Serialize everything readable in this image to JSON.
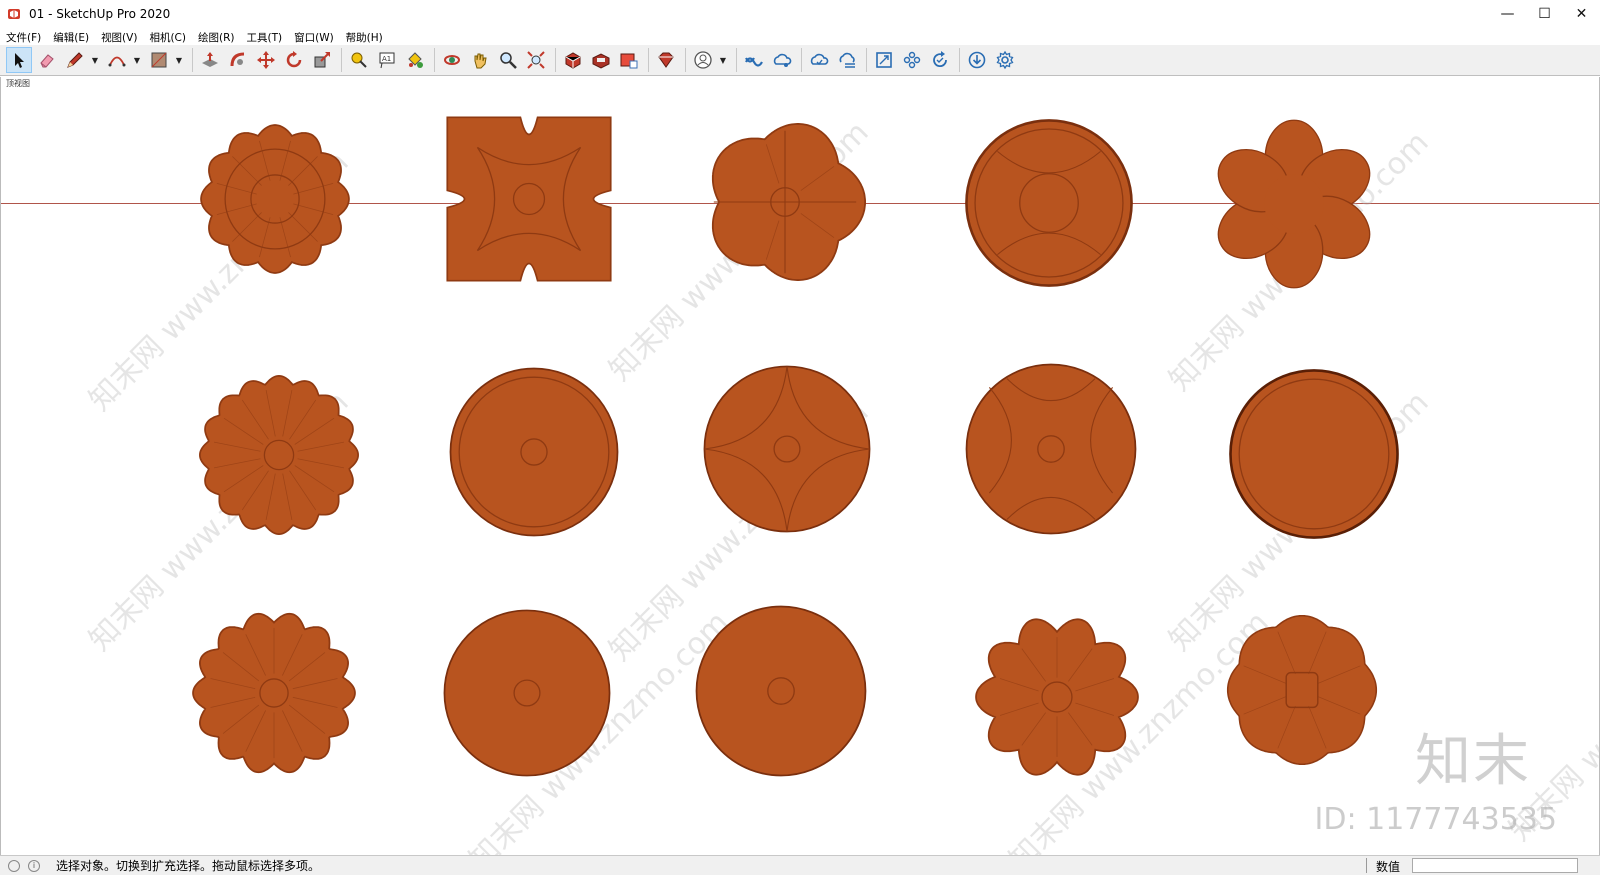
{
  "window": {
    "title": "01 - SketchUp Pro 2020",
    "minimize_glyph": "—",
    "maximize_glyph": "☐",
    "close_glyph": "✕"
  },
  "menu": {
    "items": [
      {
        "label": "文件(F)"
      },
      {
        "label": "编辑(E)"
      },
      {
        "label": "视图(V)"
      },
      {
        "label": "相机(C)"
      },
      {
        "label": "绘图(R)"
      },
      {
        "label": "工具(T)"
      },
      {
        "label": "窗口(W)"
      },
      {
        "label": "帮助(H)"
      }
    ]
  },
  "toolbar": {
    "tools": [
      {
        "icon": "select-arrow-icon"
      },
      {
        "icon": "eraser-icon"
      },
      {
        "icon": "pencil-line-icon"
      },
      {
        "icon": "arc-icon"
      },
      {
        "icon": "rectangle-icon"
      },
      {
        "icon": "push-pull-icon"
      },
      {
        "icon": "follow-me-icon"
      },
      {
        "icon": "move-icon"
      },
      {
        "icon": "rotate-icon"
      },
      {
        "icon": "scale-icon"
      },
      {
        "icon": "tape-measure-icon"
      },
      {
        "icon": "text-icon"
      },
      {
        "icon": "paint-bucket-icon"
      },
      {
        "icon": "orbit-icon"
      },
      {
        "icon": "pan-icon"
      },
      {
        "icon": "zoom-icon"
      },
      {
        "icon": "zoom-extents-icon"
      },
      {
        "icon": "3d-warehouse-icon"
      },
      {
        "icon": "extension-warehouse-icon"
      },
      {
        "icon": "layout-icon"
      },
      {
        "icon": "ruby-console-icon"
      },
      {
        "icon": "account-icon"
      },
      {
        "icon": "trimble-connect-icon"
      },
      {
        "icon": "cloud-share-icon"
      },
      {
        "icon": "cloud-sync-icon"
      },
      {
        "icon": "cloud-list-icon"
      },
      {
        "icon": "model-info-icon"
      },
      {
        "icon": "components-icon"
      },
      {
        "icon": "refresh-icon"
      },
      {
        "icon": "download-icon"
      },
      {
        "icon": "settings-gear-icon"
      }
    ]
  },
  "viewport": {
    "scene_label": "顶视图",
    "axis_color": "#b0554a",
    "wood_color": "#b8541f",
    "wood_dark": "#8f3a12",
    "watermark_text": "知末网 www.znzmo.com",
    "brand_logo": "知末",
    "brand_id": "ID: 1177743535"
  },
  "statusbar": {
    "message": "选择对象。切换到扩充选择。拖动鼠标选择多项。",
    "measure_label": "数值",
    "measure_value": ""
  }
}
